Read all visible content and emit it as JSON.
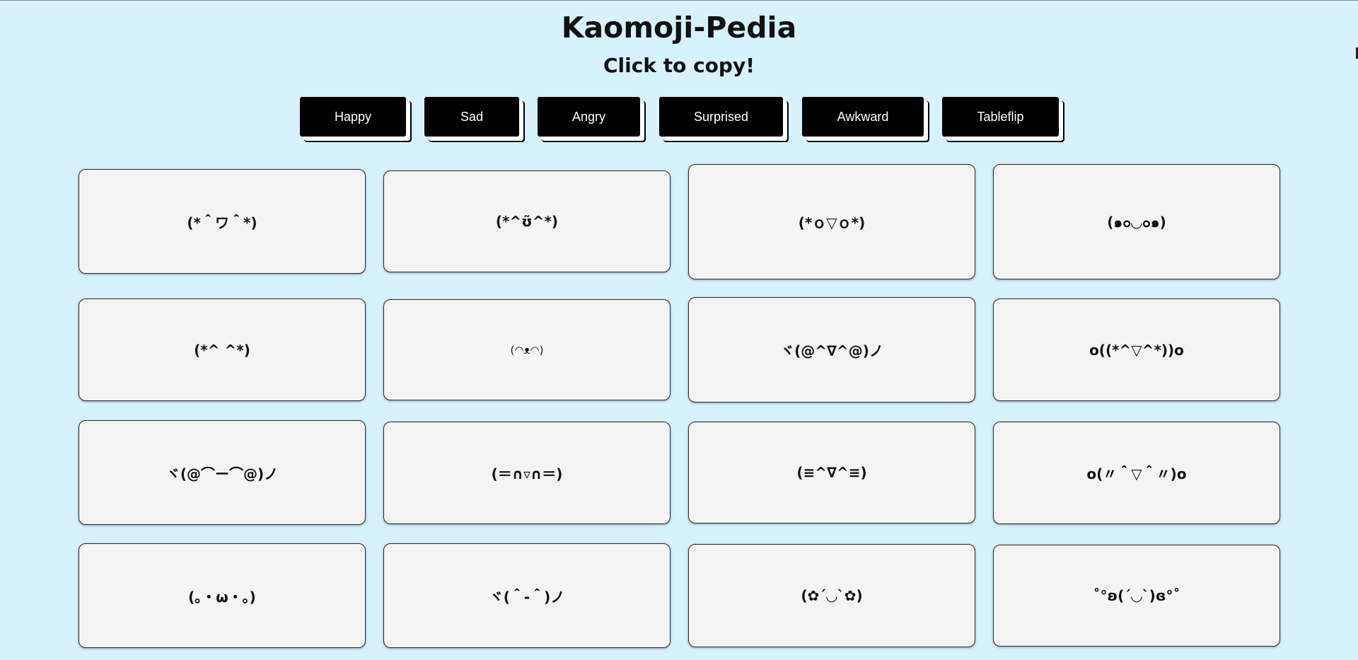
{
  "header": {
    "title": "Kaomoji-Pedia",
    "subtitle": "Click to copy!"
  },
  "categories": [
    {
      "label": "Happy"
    },
    {
      "label": "Sad"
    },
    {
      "label": "Angry"
    },
    {
      "label": "Surprised"
    },
    {
      "label": "Awkward"
    },
    {
      "label": "Tableflip"
    }
  ],
  "kaomoji": [
    "(*＾ワ＾*)",
    "(*^ʊ̃^*)",
    "(*ｏ▽ｏ*)",
    "(๑๐◡๐๑)",
    "(*^ ^*)",
    "(◠ᴥ◠)",
    "ヾ(@^∇^@)ノ",
    "o((*^▽^*))o",
    "ヾ(@⌒ー⌒@)ノ",
    "(＝∩▿∩＝)",
    "(≡^∇^≡)",
    "o(〃＾▽＾〃)o",
    "(｡・ω・｡)",
    "ヾ(＾-＾)ノ",
    "(✿´◡`✿)",
    "˚°ʚ(´◡`)ɞ°˚"
  ],
  "colors": {
    "background": "#d7f1fd",
    "card": "#f4f4f4",
    "button": "#000000",
    "button_text": "#ffffff"
  }
}
